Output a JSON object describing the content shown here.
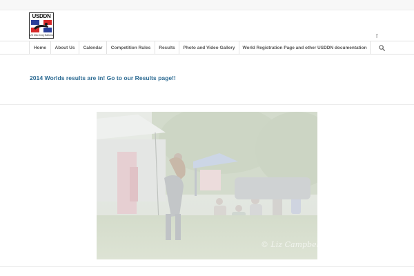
{
  "logo": {
    "text": "USDDN",
    "tagline": "US Disc Dog Nationals"
  },
  "social": {
    "facebook_label": "f"
  },
  "nav": {
    "items": [
      {
        "label": "Home"
      },
      {
        "label": "About Us"
      },
      {
        "label": "Calendar"
      },
      {
        "label": "Competition Rules"
      },
      {
        "label": "Results"
      },
      {
        "label": "Photo and Video Gallery"
      },
      {
        "label": "World Registration Page and other USDDN documentation"
      }
    ]
  },
  "main": {
    "notice": "2014 Worlds results are in! Go to our Results page!!",
    "photo_watermark": "© Liz Campbell"
  },
  "colors": {
    "link": "#2d6b93",
    "nav_text": "#555555",
    "border": "#e2e2e2"
  }
}
